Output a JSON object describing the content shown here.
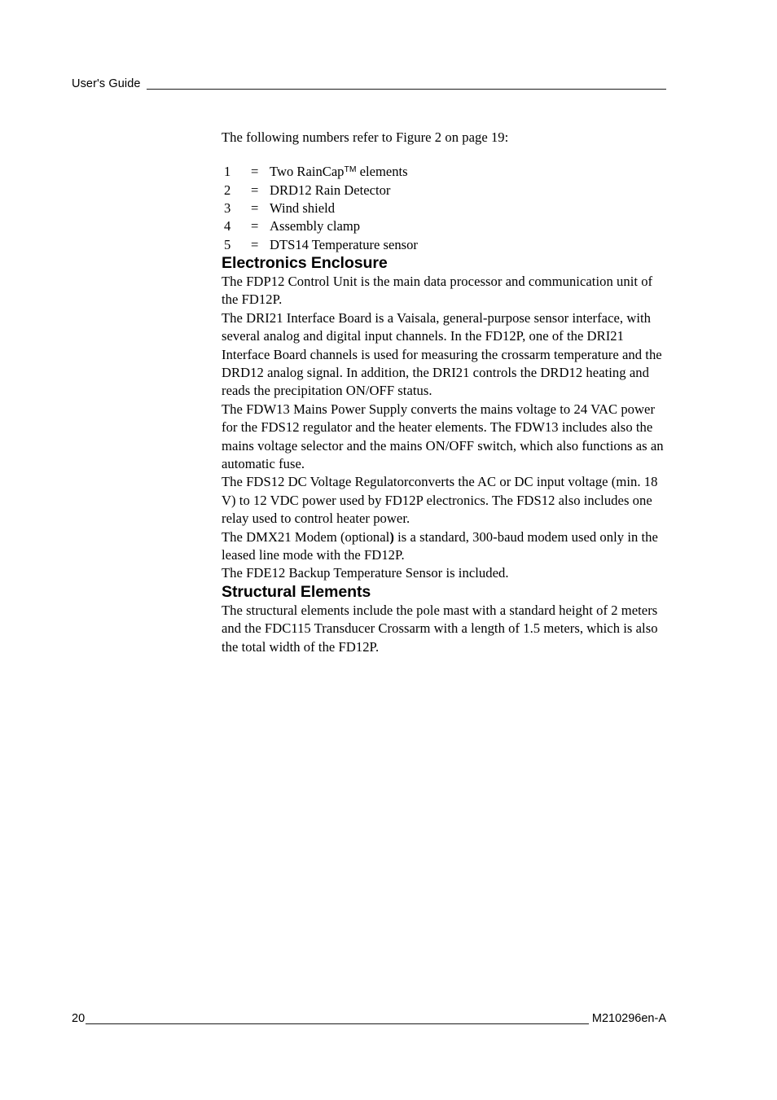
{
  "header": {
    "label": "User's Guide"
  },
  "content": {
    "intro": "The following numbers refer to Figure 2 on page 19:",
    "legend": [
      {
        "num": "1",
        "eq": "=",
        "label_before_tm": "Two RainCap",
        "tm": "TM",
        "label_after_tm": " elements"
      },
      {
        "num": "2",
        "eq": "=",
        "label": "DRD12 Rain Detector"
      },
      {
        "num": "3",
        "eq": "=",
        "label": "Wind shield"
      },
      {
        "num": "4",
        "eq": "=",
        "label": "Assembly clamp"
      },
      {
        "num": "5",
        "eq": "=",
        "label": "DTS14 Temperature sensor"
      }
    ],
    "sections": [
      {
        "heading": "Electronics Enclosure",
        "paragraphs": [
          "The FDP12 Control Unit is the main data processor and communication unit of the FD12P.",
          "The DRI21 Interface Board is a Vaisala, general-purpose sensor interface, with several analog and digital input channels. In the FD12P, one of the DRI21 Interface Board channels is used for measuring the crossarm temperature and the DRD12 analog signal. In addition, the DRI21 controls the DRD12 heating and reads the precipitation ON/OFF status.",
          "The FDW13 Mains Power Supply converts the mains voltage to 24 VAC power for the FDS12 regulator and the heater elements. The FDW13 includes also the mains voltage selector and the mains ON/OFF switch, which also functions as an automatic fuse.",
          "The FDS12 DC Voltage Regulatorconverts the AC or DC input voltage (min. 18 V) to 12 VDC power used by FD12P electronics. The FDS12 also includes one relay used to control heater power.",
          "The FDE12 Backup Temperature Sensor is included."
        ],
        "modem_paragraph": {
          "before": "The DMX21 Modem (optional",
          "bold": ")",
          "after": " is a standard, 300-baud modem used only in the leased line mode with the FD12P."
        }
      },
      {
        "heading": "Structural Elements",
        "paragraphs": [
          "The structural elements include the pole mast with a standard height of 2 meters and the FDC115 Transducer Crossarm with a length of 1.5 meters, which is also the total width of the FD12P."
        ]
      }
    ]
  },
  "footer": {
    "page_number": "20",
    "document_code": "M210296en-A"
  }
}
